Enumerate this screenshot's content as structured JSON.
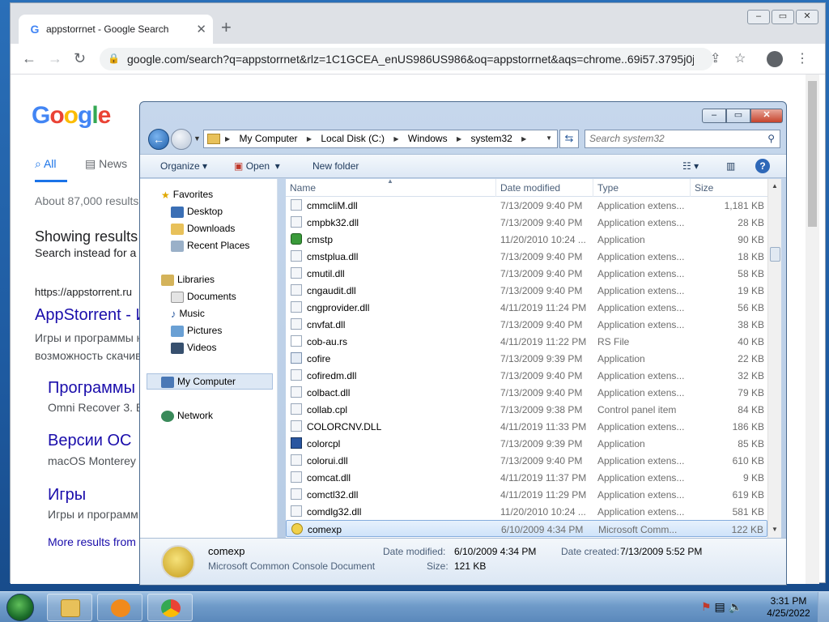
{
  "browser": {
    "tab_title": "appstorrnet - Google Search",
    "url": "google.com/search?q=appstorrnet&rlz=1C1GCEA_enUS986US986&oq=appstorrnet&aqs=chrome..69i57.3795j0j...",
    "google_logo": "Google",
    "tabs": [
      "All",
      "News"
    ],
    "results_count": "About 87,000 results",
    "showing_results": "Showing results",
    "search_instead": "Search instead for a",
    "result_url": "https://appstorrent.ru",
    "result_title": "AppStorrent - И",
    "result_snippet_1": "Игры и программы н",
    "result_snippet_2": "возможность скачив",
    "sub1_title": "Программы",
    "sub1_snippet": "Omni Recover 3. В",
    "sub2_title": "Версии ОС",
    "sub2_snippet": "macOS Monterey",
    "sub3_title": "Игры",
    "sub3_snippet": "Игры и программ",
    "more_results": "More results from"
  },
  "explorer": {
    "breadcrumb": [
      "My Computer",
      "Local Disk (C:)",
      "Windows",
      "system32"
    ],
    "search_placeholder": "Search system32",
    "toolbar": {
      "organize": "Organize",
      "open": "Open",
      "new_folder": "New folder"
    },
    "nav": {
      "favorites": "Favorites",
      "desktop": "Desktop",
      "downloads": "Downloads",
      "recent": "Recent Places",
      "libraries": "Libraries",
      "documents": "Documents",
      "music": "Music",
      "pictures": "Pictures",
      "videos": "Videos",
      "computer": "My Computer",
      "network": "Network"
    },
    "columns": {
      "name": "Name",
      "date": "Date modified",
      "type": "Type",
      "size": "Size"
    },
    "files": [
      {
        "name": "cmmcliM.dll",
        "date": "7/13/2009 9:40 PM",
        "type": "Application extens...",
        "size": "1,181 KB",
        "icon": "dll"
      },
      {
        "name": "cmpbk32.dll",
        "date": "7/13/2009 9:40 PM",
        "type": "Application extens...",
        "size": "28 KB",
        "icon": "dll"
      },
      {
        "name": "cmstp",
        "date": "11/20/2010 10:24 ...",
        "type": "Application",
        "size": "90 KB",
        "icon": "app-green"
      },
      {
        "name": "cmstplua.dll",
        "date": "7/13/2009 9:40 PM",
        "type": "Application extens...",
        "size": "18 KB",
        "icon": "dll"
      },
      {
        "name": "cmutil.dll",
        "date": "7/13/2009 9:40 PM",
        "type": "Application extens...",
        "size": "58 KB",
        "icon": "dll"
      },
      {
        "name": "cngaudit.dll",
        "date": "7/13/2009 9:40 PM",
        "type": "Application extens...",
        "size": "19 KB",
        "icon": "dll"
      },
      {
        "name": "cngprovider.dll",
        "date": "4/11/2019 11:24 PM",
        "type": "Application extens...",
        "size": "56 KB",
        "icon": "dll"
      },
      {
        "name": "cnvfat.dll",
        "date": "7/13/2009 9:40 PM",
        "type": "Application extens...",
        "size": "38 KB",
        "icon": "dll"
      },
      {
        "name": "cob-au.rs",
        "date": "4/11/2019 11:22 PM",
        "type": "RS File",
        "size": "40 KB",
        "icon": "file"
      },
      {
        "name": "cofire",
        "date": "7/13/2009 9:39 PM",
        "type": "Application",
        "size": "22 KB",
        "icon": "app"
      },
      {
        "name": "cofiredm.dll",
        "date": "7/13/2009 9:40 PM",
        "type": "Application extens...",
        "size": "32 KB",
        "icon": "dll"
      },
      {
        "name": "colbact.dll",
        "date": "7/13/2009 9:40 PM",
        "type": "Application extens...",
        "size": "79 KB",
        "icon": "dll"
      },
      {
        "name": "collab.cpl",
        "date": "7/13/2009 9:38 PM",
        "type": "Control panel item",
        "size": "84 KB",
        "icon": "dll"
      },
      {
        "name": "COLORCNV.DLL",
        "date": "4/11/2019 11:33 PM",
        "type": "Application extens...",
        "size": "186 KB",
        "icon": "dll"
      },
      {
        "name": "colorcpl",
        "date": "7/13/2009 9:39 PM",
        "type": "Application",
        "size": "85 KB",
        "icon": "app-monitor"
      },
      {
        "name": "colorui.dll",
        "date": "7/13/2009 9:40 PM",
        "type": "Application extens...",
        "size": "610 KB",
        "icon": "dll"
      },
      {
        "name": "comcat.dll",
        "date": "4/11/2019 11:37 PM",
        "type": "Application extens...",
        "size": "9 KB",
        "icon": "dll"
      },
      {
        "name": "comctl32.dll",
        "date": "4/11/2019 11:29 PM",
        "type": "Application extens...",
        "size": "619 KB",
        "icon": "dll"
      },
      {
        "name": "comdlg32.dll",
        "date": "11/20/2010 10:24 ...",
        "type": "Application extens...",
        "size": "581 KB",
        "icon": "dll"
      },
      {
        "name": "comexp",
        "date": "6/10/2009 4:34 PM",
        "type": "Microsoft Comm...",
        "size": "122 KB",
        "icon": "msc",
        "selected": true
      }
    ],
    "details": {
      "name": "comexp",
      "type": "Microsoft Common Console Document",
      "modified_label": "Date modified:",
      "modified": "6/10/2009 4:34 PM",
      "created_label": "Date created:",
      "created": "7/13/2009 5:52 PM",
      "size_label": "Size:",
      "size": "121 KB"
    }
  },
  "taskbar": {
    "time": "3:31 PM",
    "date": "4/25/2022"
  },
  "colors": {
    "selection": "#cfe3fa",
    "accent_blue": "#1a73e8",
    "link": "#1a0dab"
  }
}
